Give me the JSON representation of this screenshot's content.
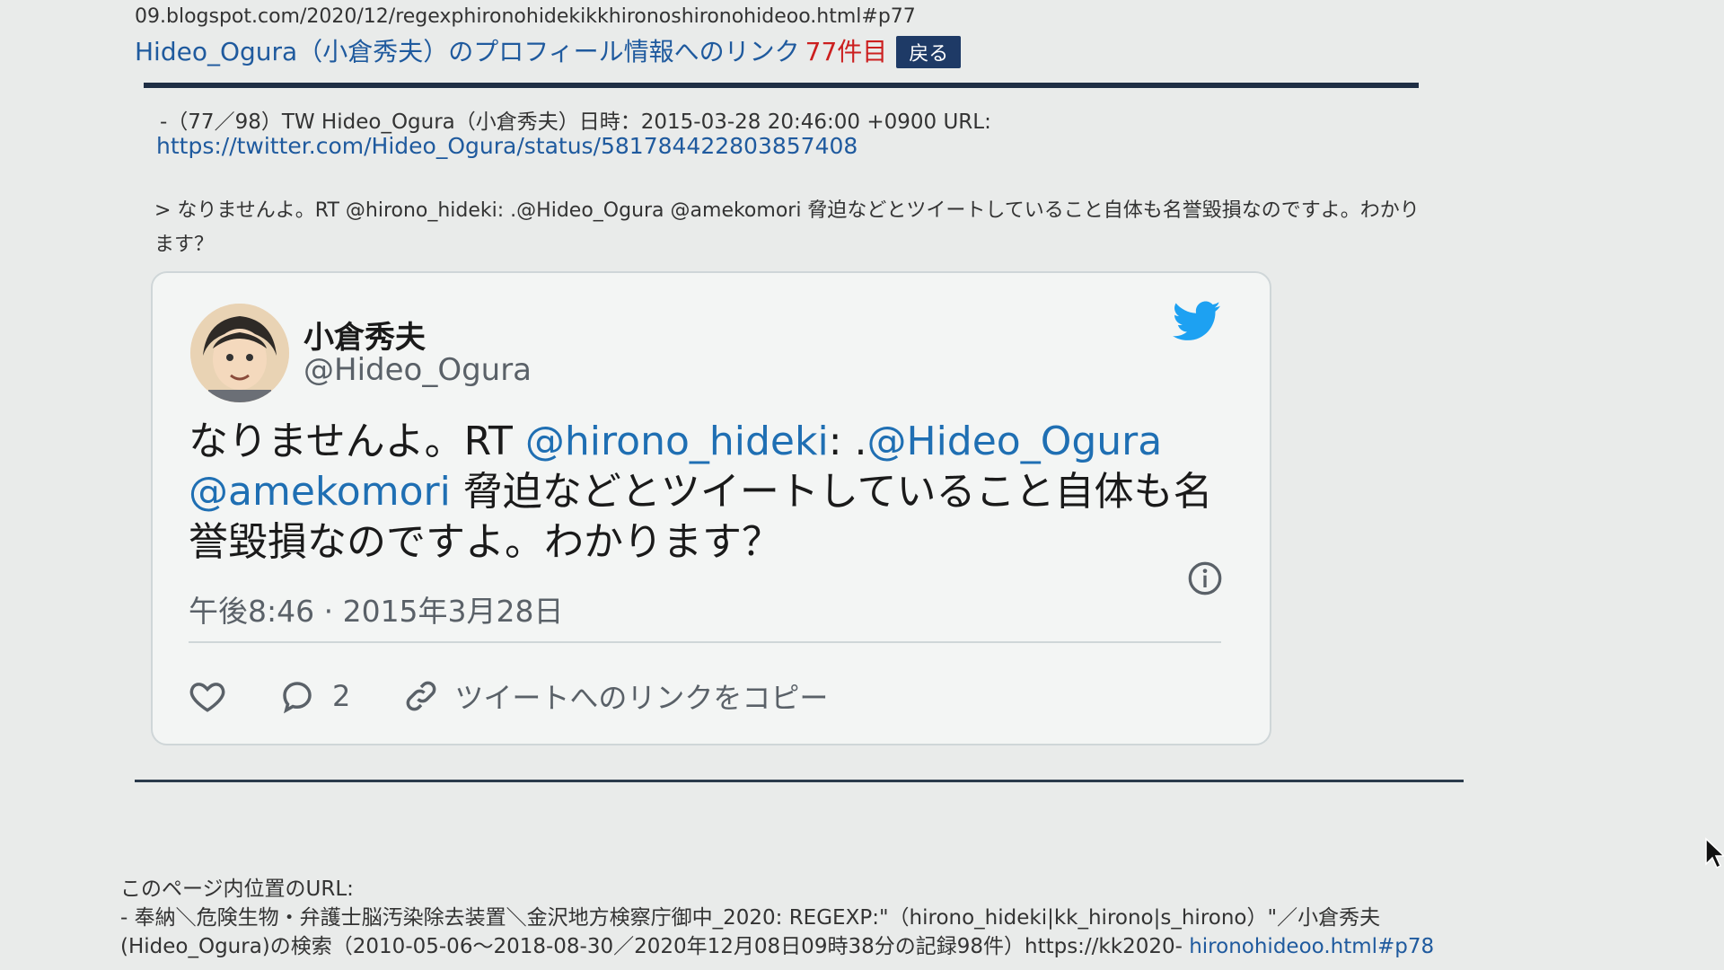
{
  "header": {
    "url_line": "09.blogspot.com/2020/12/regexphironohidekikkhironoshironohideoo.html#p77",
    "profile_link": "Hideo_Ogura（小倉秀夫）のプロフィール情報へのリンク",
    "count": "77件目",
    "back_button": "戻る"
  },
  "entry": {
    "meta": "-（77／98）TW Hideo_Ogura（小倉秀夫）日時：2015-03-28 20:46:00 +0900 URL:",
    "url": "https://twitter.com/Hideo_Ogura/status/581784422803857408",
    "quote": "> なりませんよ。RT @hirono_hideki: .@Hideo_Ogura @amekomori 脅迫などとツイートしていること自体も名誉毀損なのですよ。わかります？"
  },
  "tweet": {
    "author_name": "小倉秀夫",
    "author_handle": "@Hideo_Ogura",
    "text_prefix": "なりませんよ。RT ",
    "mention_1": "@hirono_hideki",
    "text_colon": ": .",
    "mention_2": "@Hideo_Ogura",
    "mention_3": "@amekomori",
    "text_rest": " 脅迫などとツイートしていること自体も名誉毀損なのですよ。わかります？",
    "timestamp": "午後8:46 · 2015年3月28日",
    "reply_count": "2",
    "copy_link_label": "ツイートへのリンクをコピー",
    "brand_color": "#1da1f2"
  },
  "footer": {
    "line1": "このページ内位置のURL:",
    "line1_right": "（hirono_hideki|kk_hirono|s_hirono）\"／小倉秀夫",
    "line2": "- 奉納＼危険生物・弁護士脳汚染除去装置＼金沢地方検察庁御中_2020: REGEXP:\"",
    "line3": "記録98件）https://kk2020-",
    "line3_full": "（2010-05-06～2018-08-30／2020年12月08日09時38分の記録98件）https://kk2020-",
    "line4": "(Hideo_Ogura)の検索（2010-05-06～2018-08-30／2020年12月08日09時38分の",
    "line5": "hironohideoo.html#p78"
  }
}
